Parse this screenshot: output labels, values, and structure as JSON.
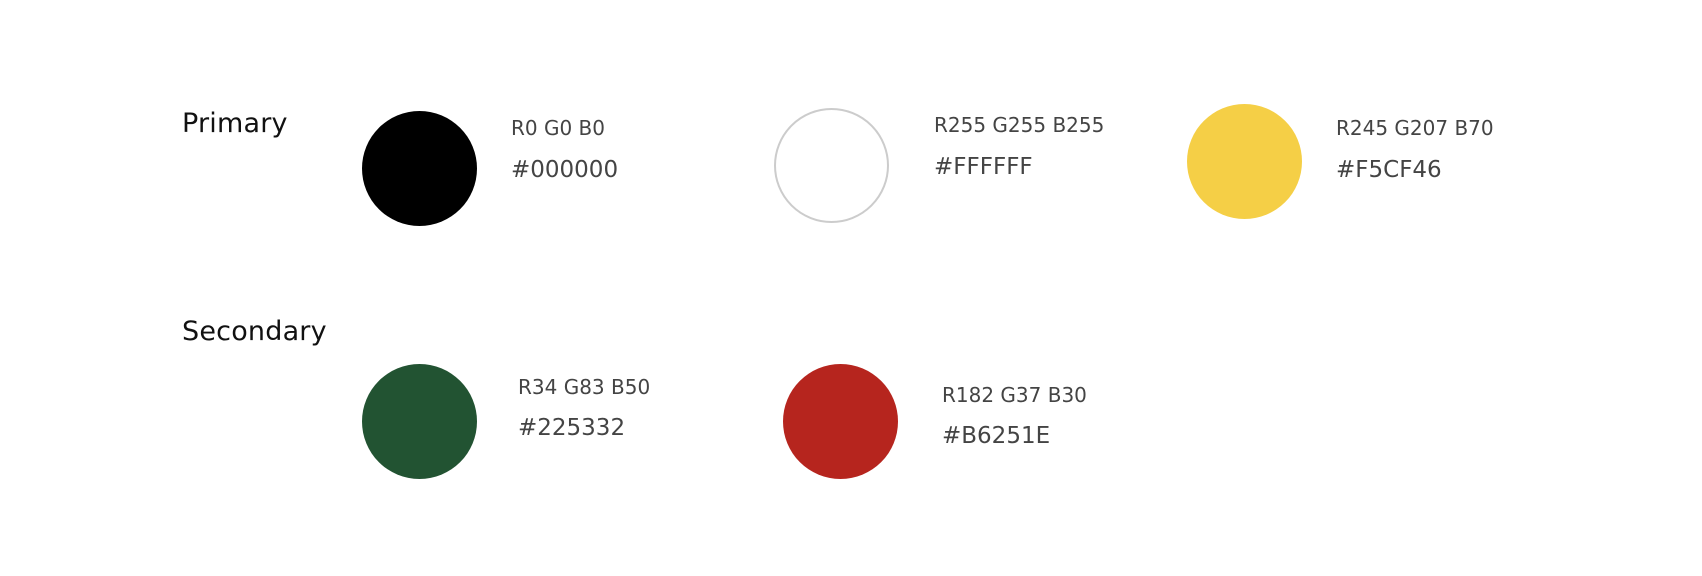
{
  "primary": {
    "title": "Primary",
    "swatches": [
      {
        "rgb": "R0 G0 B0",
        "hex": "#000000",
        "color": "#000000",
        "border": "none"
      },
      {
        "rgb": "R255 G255 B255",
        "hex": "#FFFFFF",
        "color": "#FFFFFF",
        "border": "#cccccc"
      },
      {
        "rgb": "R245 G207 B70",
        "hex": "#F5CF46",
        "color": "#F5CF46",
        "border": "none"
      }
    ]
  },
  "secondary": {
    "title": "Secondary",
    "swatches": [
      {
        "rgb": "R34 G83 B50",
        "hex": "#225332",
        "color": "#225332",
        "border": "none"
      },
      {
        "rgb": "R182 G37 B30",
        "hex": "#B6251E",
        "color": "#B6251E",
        "border": "none"
      }
    ]
  }
}
